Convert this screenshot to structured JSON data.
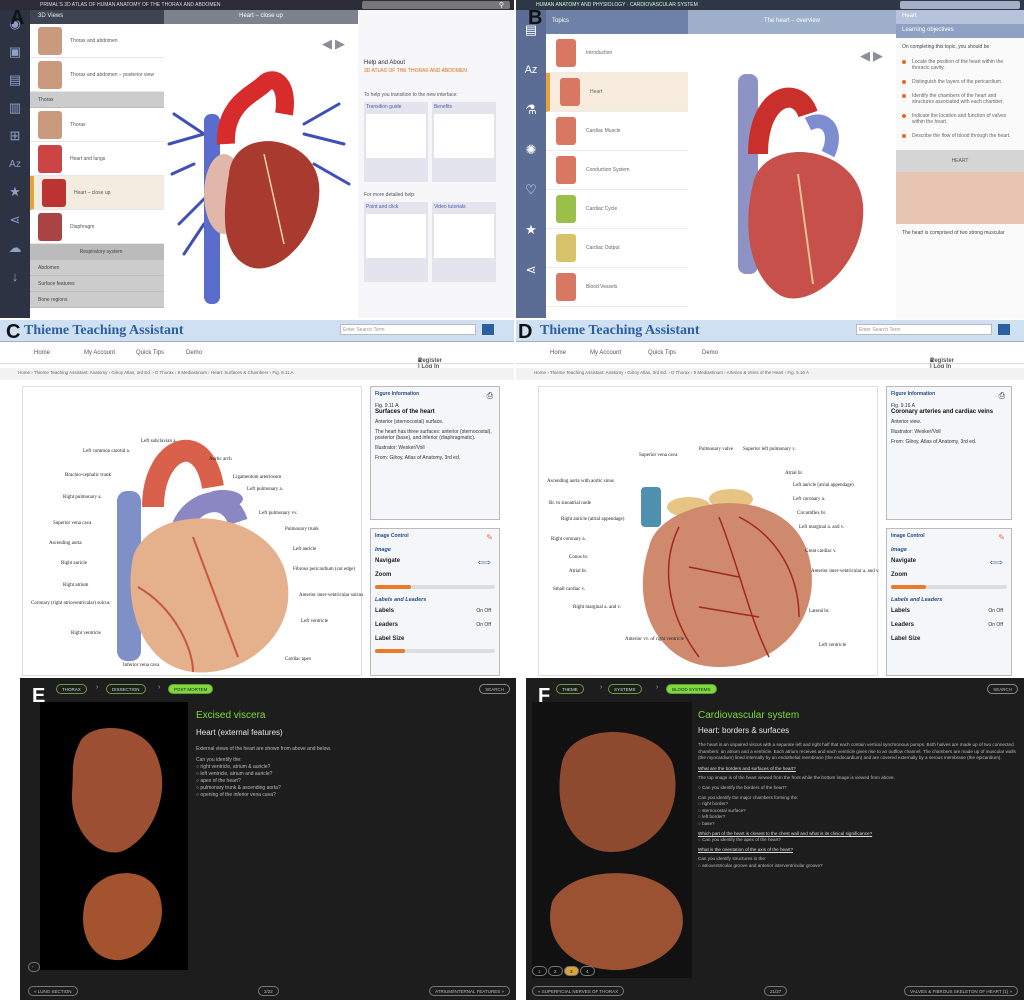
{
  "labels": {
    "a": "A",
    "b": "B",
    "c": "C",
    "d": "D",
    "e": "E",
    "f": "F"
  },
  "colors": {
    "accent_orange": "#e8a23a",
    "thieme_blue": "#2b5fa0",
    "green": "#7ed93a",
    "dark_bg": "#1d1d1d"
  },
  "panel_a": {
    "topbar_title": "PRIMAL'S 3D ATLAS OF HUMAN ANATOMY OF THE THORAX AND ABDOMEN",
    "list_header": "3D Views",
    "view_header": "Heart – close up",
    "items": [
      {
        "label": "Thorax and abdomen"
      },
      {
        "label": "Thorax and abdomen – posterior view"
      }
    ],
    "section_thorax": "Thorax",
    "items2": [
      {
        "label": "Thorax"
      },
      {
        "label": "Heart and lungs"
      },
      {
        "label": "Heart – close up"
      },
      {
        "label": "Diaphragm"
      }
    ],
    "section_resp": "Respiratory system",
    "section_abdomen": "Abdomen",
    "section_surface": "Surface features",
    "section_bone": "Bone regions",
    "help_title": "Help and About",
    "help_sub": "3D ATLAS OF THE THORAX AND ABDOMEN",
    "help_transition": "To help you transition to the new interface:",
    "tile1": "Transition guide",
    "tile2": "Benefits",
    "help_more": "For more detailed help:",
    "tile3": "Point and click",
    "tile4": "Video tutorials"
  },
  "panel_b": {
    "topbar_title": "HUMAN ANATOMY AND PHYSIOLOGY · CARDIOVASCULAR SYSTEM",
    "list_header": "Topics",
    "view_header": "The heart – overview",
    "side_header": "Heart",
    "side_sub": "Learning objectives",
    "intro": "On completing this topic, you should be",
    "objectives": [
      "Locate the position of the heart within the thoracic cavity.",
      "Distinguish the layers of the pericardium.",
      "Identify the chambers of the heart and structures associated with each chamber.",
      "Indicate the location and function of valves within the heart.",
      "Describe the flow of blood through the heart."
    ],
    "heart_bar": "HEART",
    "footer_text": "The heart is comprised of two strong muscular",
    "items": [
      {
        "label": "Introduction"
      },
      {
        "label": "Heart"
      },
      {
        "label": "Cardiac Muscle"
      },
      {
        "label": "Conduction System"
      },
      {
        "label": "Cardiac Cycle"
      },
      {
        "label": "Cardiac Output"
      },
      {
        "label": "Blood Vessels"
      }
    ]
  },
  "panel_c": {
    "logo": "Thieme  Teaching Assistant",
    "search_placeholder": "Enter Search Term",
    "nav": [
      "Home",
      "My Account",
      "Quick Tips",
      "Demo"
    ],
    "register": "Register | Log In",
    "crumb": "Home › Thieme Teaching Assistant: Anatomy › Gilroy Atlas, 3rd Ed. › D Thorax › 9 Mediastinum › Heart: Surfaces & Chambers › Fig. 9.11 A",
    "fig_info_title": "Figure Information",
    "fig_no": "Fig. 9.11 A",
    "fig_title": "Surfaces of the heart",
    "fig_view": "Anterior (sternocostal) surface.",
    "fig_desc": "The heart has three surfaces: anterior (sternocostal), posterior (base), and inferior (diaphragmatic).",
    "illustrator": "Illustrator: Wesker/Voll",
    "source": "From: Gilroy, Atlas of Anatomy, 3rd ed.",
    "ctrl_title": "Image Control",
    "image": "Image",
    "navigate": "Navigate",
    "zoom": "Zoom",
    "labels_leaders": "Labels and Leaders",
    "labels": "Labels",
    "leaders": "Leaders",
    "label_size": "Label Size",
    "onoff": "On  Off",
    "zoom_level": 0.3,
    "label_size_level": 0.25,
    "anno": [
      "Left subclavian a.",
      "Left common carotid a.",
      "Aortic arch",
      "Brachio-cephalic trunk",
      "Ligamentum arteriosum",
      "Left pulmonary a.",
      "Right pulmonary a.",
      "Left pulmonary vv.",
      "Superior vena cava",
      "Pulmonary trunk",
      "Ascending aorta",
      "Left auricle",
      "Right auricle",
      "Fibrous pericardium (cut edge)",
      "Right atrium",
      "Anterior inter-ventricular sulcus",
      "Coronary (right atrioventricular) sulcus",
      "Left ventricle",
      "Right ventricle",
      "Inferior vena cava",
      "Cardiac apex"
    ]
  },
  "panel_d": {
    "logo": "Thieme  Teaching Assistant",
    "search_placeholder": "Enter Search Term",
    "nav": [
      "Home",
      "My Account",
      "Quick Tips",
      "Demo"
    ],
    "register": "Register | Log In",
    "crumb": "Home › Thieme Teaching Assistant: Anatomy › Gilroy Atlas, 3rd Ed. › D Thorax › 9 Mediastinum › Arteries & Veins of the Heart › Fig. 9.16 A",
    "fig_info_title": "Figure Information",
    "fig_no": "Fig. 9.16 A",
    "fig_title": "Coronary arteries and cardiac veins",
    "fig_view": "Anterior view.",
    "illustrator": "Illustrator: Wesker/Voll",
    "source": "From: Gilroy, Atlas of Anatomy, 3rd ed.",
    "ctrl_title": "Image Control",
    "image": "Image",
    "navigate": "Navigate",
    "zoom": "Zoom",
    "labels_leaders": "Labels and Leaders",
    "labels": "Labels",
    "leaders": "Leaders",
    "label_size": "Label Size",
    "onoff": "On  Off",
    "zoom_level": 0.3,
    "anno": [
      "Superior vena cava",
      "Pulmonary valve",
      "Superior left pulmonary v.",
      "Atrial br.",
      "Ascending aorta with aortic sinus",
      "Left auricle (atrial appendage)",
      "Br. to sinoatrial node",
      "Left coronary a.",
      "Right auricle (atrial appendage)",
      "Circumflex br.",
      "Right coronary a.",
      "Left marginal a. and v.",
      "Great cardiac v.",
      "Conus br.",
      "Atrial br.",
      "Anterior inter-ventricular a. and v.",
      "Small cardiac v.",
      "Right marginal a. and v.",
      "Lateral br.",
      "Anterior vv. of right ventricle",
      "Left ventricle"
    ]
  },
  "panel_e": {
    "pills": [
      "THORAX",
      "DISSECTION",
      "POST MORTEM"
    ],
    "search": "SEARCH",
    "title": "Excised viscera",
    "subtitle": "Heart (external features)",
    "intro": "External views of the heart are shown from above and below.",
    "question": "Can you identify the:",
    "items": [
      "right ventricle, atrium & auricle?",
      "left ventricle, atrium and auricle?",
      "apex of the heart?",
      "pulmonary trunk & ascending aorta?",
      "opening of the inferior vena cava?"
    ],
    "back": "« LUNG SECTION",
    "page": "2/22",
    "next": "ATRIUM/INTERNAL FEATURES »"
  },
  "panel_f": {
    "pills": [
      "THEME",
      "SYSTEMS",
      "BLOOD SYSTEMS"
    ],
    "search": "SEARCH",
    "title": "Cardiovascular system",
    "subtitle": "Heart: borders & surfaces",
    "para": "The heart is an unpaired viscus with a separate left and right half that each contain vertical synchronous pumps. Both halves are made up of two connected chambers: an atrium and a ventricle. Each atrium receives and each ventricle gives rise to an outflow channel. The chambers are made up of muscular walls (the myocardium) lined internally by an endothelial membrane (the endocardium) and are covered externally by a serous membrane (the epicardium).",
    "link1": "What are the borders and surfaces of the heart?",
    "p2": "The top image is of the heart viewed from the front while the bottom image is viewed from above.",
    "q1": "Can you identify the borders of the heart?",
    "q2": "Can you identify the major chambers forming the:",
    "q2items": [
      "right border?",
      "sternocostal surface?",
      "left border?",
      "base?"
    ],
    "link2": "Which part of the heart is closest to the chest wall and what is its clinical significance?",
    "q3": "Can you identify the apex of the heart?",
    "link3": "What is the orientation of the axis of the heart?",
    "q4": "Can you identify structures in the:",
    "q4items": [
      "atrioventricular groove and anterior interventricular groove?"
    ],
    "dots": [
      "1",
      "2",
      "3",
      "4"
    ],
    "back": "« SUPERFICIAL NERVES OF THORAX",
    "page": "21/27",
    "next": "VALVES & FIBROUS SKELETON OF HEART (1) »"
  }
}
